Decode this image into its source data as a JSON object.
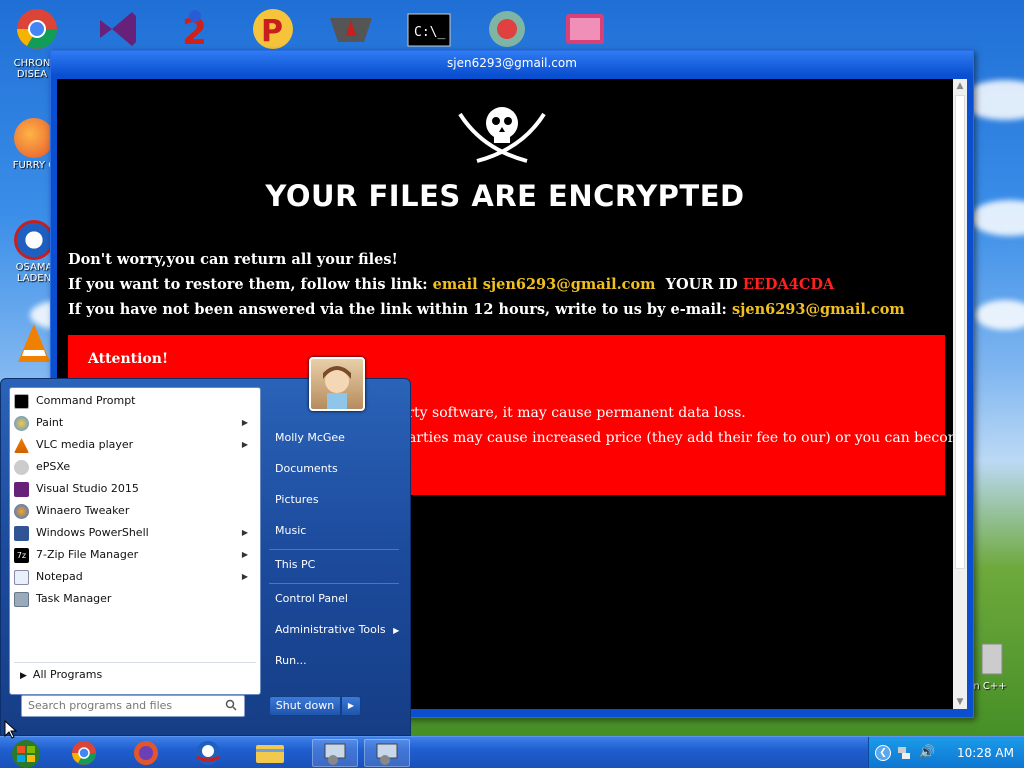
{
  "desktop": {
    "icons": [
      {
        "label": "CHRON\nDISEA"
      },
      {
        "label": "FURRY C"
      },
      {
        "label": "OSAMA\nLADEN"
      },
      {
        "label": ""
      }
    ],
    "recycle_label": "n C++"
  },
  "window": {
    "title": "sjen6293@gmail.com",
    "headline": "YOUR FILES ARE ENCRYPTED",
    "line1": "Don't worry,you can return all your files!",
    "line2_prefix": "If you want to restore them, follow this link:",
    "line2_email": "email sjen6293@gmail.com",
    "line2_id_label": "YOUR ID",
    "line2_id": "EEDA4CDA",
    "line3_prefix": "If you have not been answered via the link within 12 hours, write to us by e-mail:",
    "line3_email": "sjen6293@gmail.com",
    "attention": "Attention!",
    "warn1": "arty software, it may cause permanent data loss.",
    "warn2": "parties may cause increased price (they add their fee to our) or you can become"
  },
  "start_menu": {
    "pinned": [
      {
        "label": "Command Prompt",
        "icon": "cmd-icon",
        "submenu": false
      },
      {
        "label": "Paint",
        "icon": "paint-icon",
        "submenu": true
      },
      {
        "label": "VLC media player",
        "icon": "vlc-icon",
        "submenu": true
      },
      {
        "label": "ePSXe",
        "icon": "epsxe-icon",
        "submenu": false
      },
      {
        "label": "Visual Studio 2015",
        "icon": "visual-studio-icon",
        "submenu": false
      },
      {
        "label": "Winaero Tweaker",
        "icon": "winaero-icon",
        "submenu": false
      },
      {
        "label": "Windows PowerShell",
        "icon": "powershell-icon",
        "submenu": true
      },
      {
        "label": "7-Zip File Manager",
        "icon": "7zip-icon",
        "submenu": true
      },
      {
        "label": "Notepad",
        "icon": "notepad-icon",
        "submenu": true
      },
      {
        "label": "Task Manager",
        "icon": "task-manager-icon",
        "submenu": false
      }
    ],
    "all_programs": "All Programs",
    "search_placeholder": "Search programs and files",
    "right": {
      "user": "Molly McGee",
      "documents": "Documents",
      "pictures": "Pictures",
      "music": "Music",
      "this_pc": "This PC",
      "control_panel": "Control Panel",
      "admin_tools": "Administrative Tools",
      "run": "Run..."
    },
    "shutdown": "Shut down"
  },
  "taskbar": {
    "clock": "10:28 AM"
  },
  "colors": {
    "headline_bg": "#000000",
    "alert_red": "#ff0000",
    "email_yellow": "#f0c020",
    "id_red": "#ff2020"
  }
}
